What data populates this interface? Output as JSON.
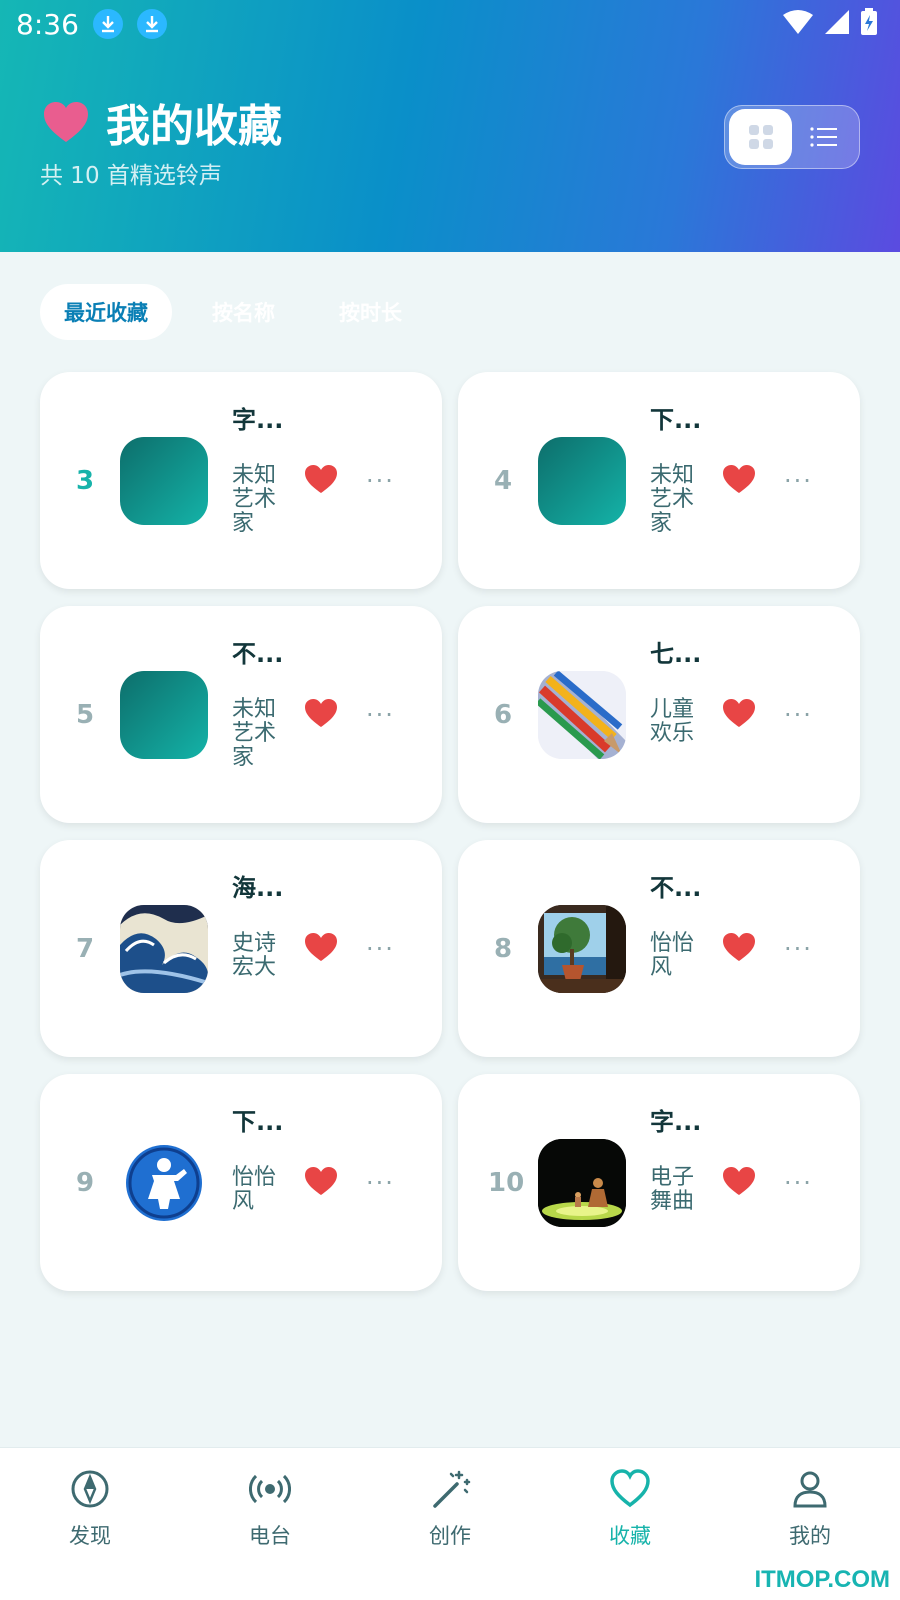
{
  "status_bar": {
    "time": "8:36"
  },
  "header": {
    "title": "我的收藏",
    "subtitle": "共 10 首精选铃声",
    "view_modes": [
      "grid",
      "list"
    ],
    "active_view": "grid"
  },
  "sort_tabs": [
    {
      "label": "最近收藏",
      "active": true
    },
    {
      "label": "按名称",
      "active": false
    },
    {
      "label": "按时长",
      "active": false
    }
  ],
  "songs": [
    {
      "rank": "3",
      "title": "字...",
      "artist": "未知艺术家",
      "thumb": "teal-gradient"
    },
    {
      "rank": "4",
      "title": "下...",
      "artist": "未知艺术家",
      "thumb": "teal-gradient"
    },
    {
      "rank": "5",
      "title": "不...",
      "artist": "未知艺术家",
      "thumb": "teal-gradient"
    },
    {
      "rank": "6",
      "title": "七...",
      "artist": "儿童欢乐",
      "thumb": "colored-pencils"
    },
    {
      "rank": "7",
      "title": "海...",
      "artist": "史诗宏大",
      "thumb": "great-wave"
    },
    {
      "rank": "8",
      "title": "不...",
      "artist": "怡怡风",
      "thumb": "bonsai-window"
    },
    {
      "rank": "9",
      "title": "下...",
      "artist": "怡怡风",
      "thumb": "blue-figure-badge"
    },
    {
      "rank": "10",
      "title": "字...",
      "artist": "电子舞曲",
      "thumb": "dark-stage"
    }
  ],
  "bottom_nav": [
    {
      "label": "发现",
      "icon": "compass-icon",
      "active": false
    },
    {
      "label": "电台",
      "icon": "radio-icon",
      "active": false
    },
    {
      "label": "创作",
      "icon": "magic-wand-icon",
      "active": false
    },
    {
      "label": "收藏",
      "icon": "heart-icon",
      "active": true
    },
    {
      "label": "我的",
      "icon": "user-icon",
      "active": false
    }
  ],
  "watermark": "ITMOP.COM",
  "colors": {
    "accent": "#17b3aa",
    "heart": "#e84545",
    "header_start": "#15b7b5",
    "header_end": "#5b4be0"
  }
}
